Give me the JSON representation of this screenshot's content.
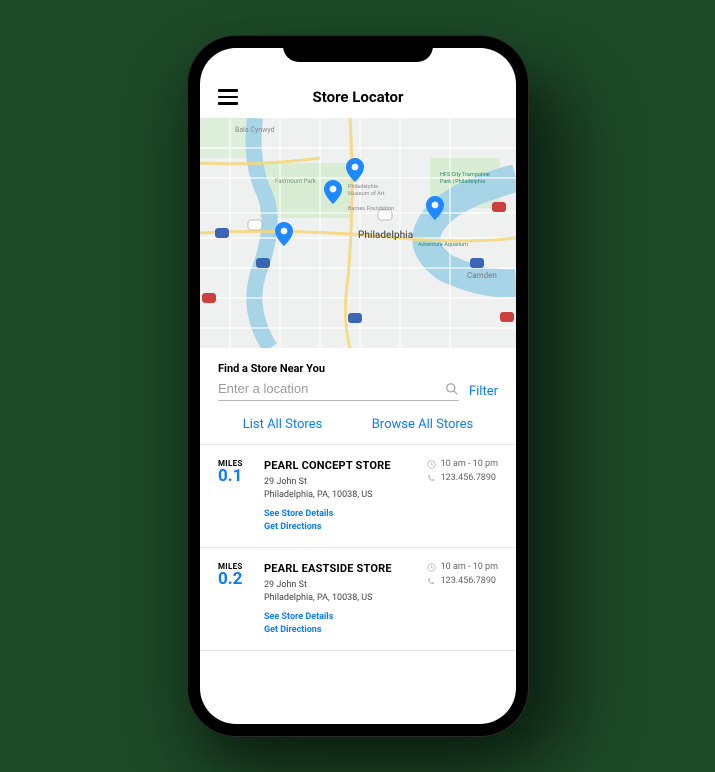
{
  "header": {
    "title": "Store Locator"
  },
  "map": {
    "city_label": "Philadelphia",
    "camden_label": "Camden",
    "labels": {
      "bala": "Bala Cynwyd",
      "fairmount": "Fairmount Park",
      "museum": "Philadelphia\nMuseum of Art",
      "barnes": "Barnes Foundation",
      "hfs": "HFS City Trampoline\nPark | Philadelphia",
      "adventure": "Adventure Aquarium"
    }
  },
  "search": {
    "label": "Find a Store Near You",
    "placeholder": "Enter a location",
    "filter": "Filter",
    "list_all": "List All Stores",
    "browse_all": "Browse All Stores"
  },
  "miles_label": "MILES",
  "detail_links": {
    "details": "See Store Details",
    "directions": "Get Directions"
  },
  "stores": [
    {
      "dist": "0.1",
      "name": "PEARL CONCEPT STORE",
      "addr1": "29 John St",
      "addr2": "Philadelphia, PA, 10038, US",
      "hours": "10 am - 10 pm",
      "phone": "123.456.7890"
    },
    {
      "dist": "0.2",
      "name": "PEARL EASTSIDE STORE",
      "addr1": "29 John St",
      "addr2": "Philadelphia, PA, 10038, US",
      "hours": "10 am - 10 pm",
      "phone": "123.456.7890"
    }
  ]
}
